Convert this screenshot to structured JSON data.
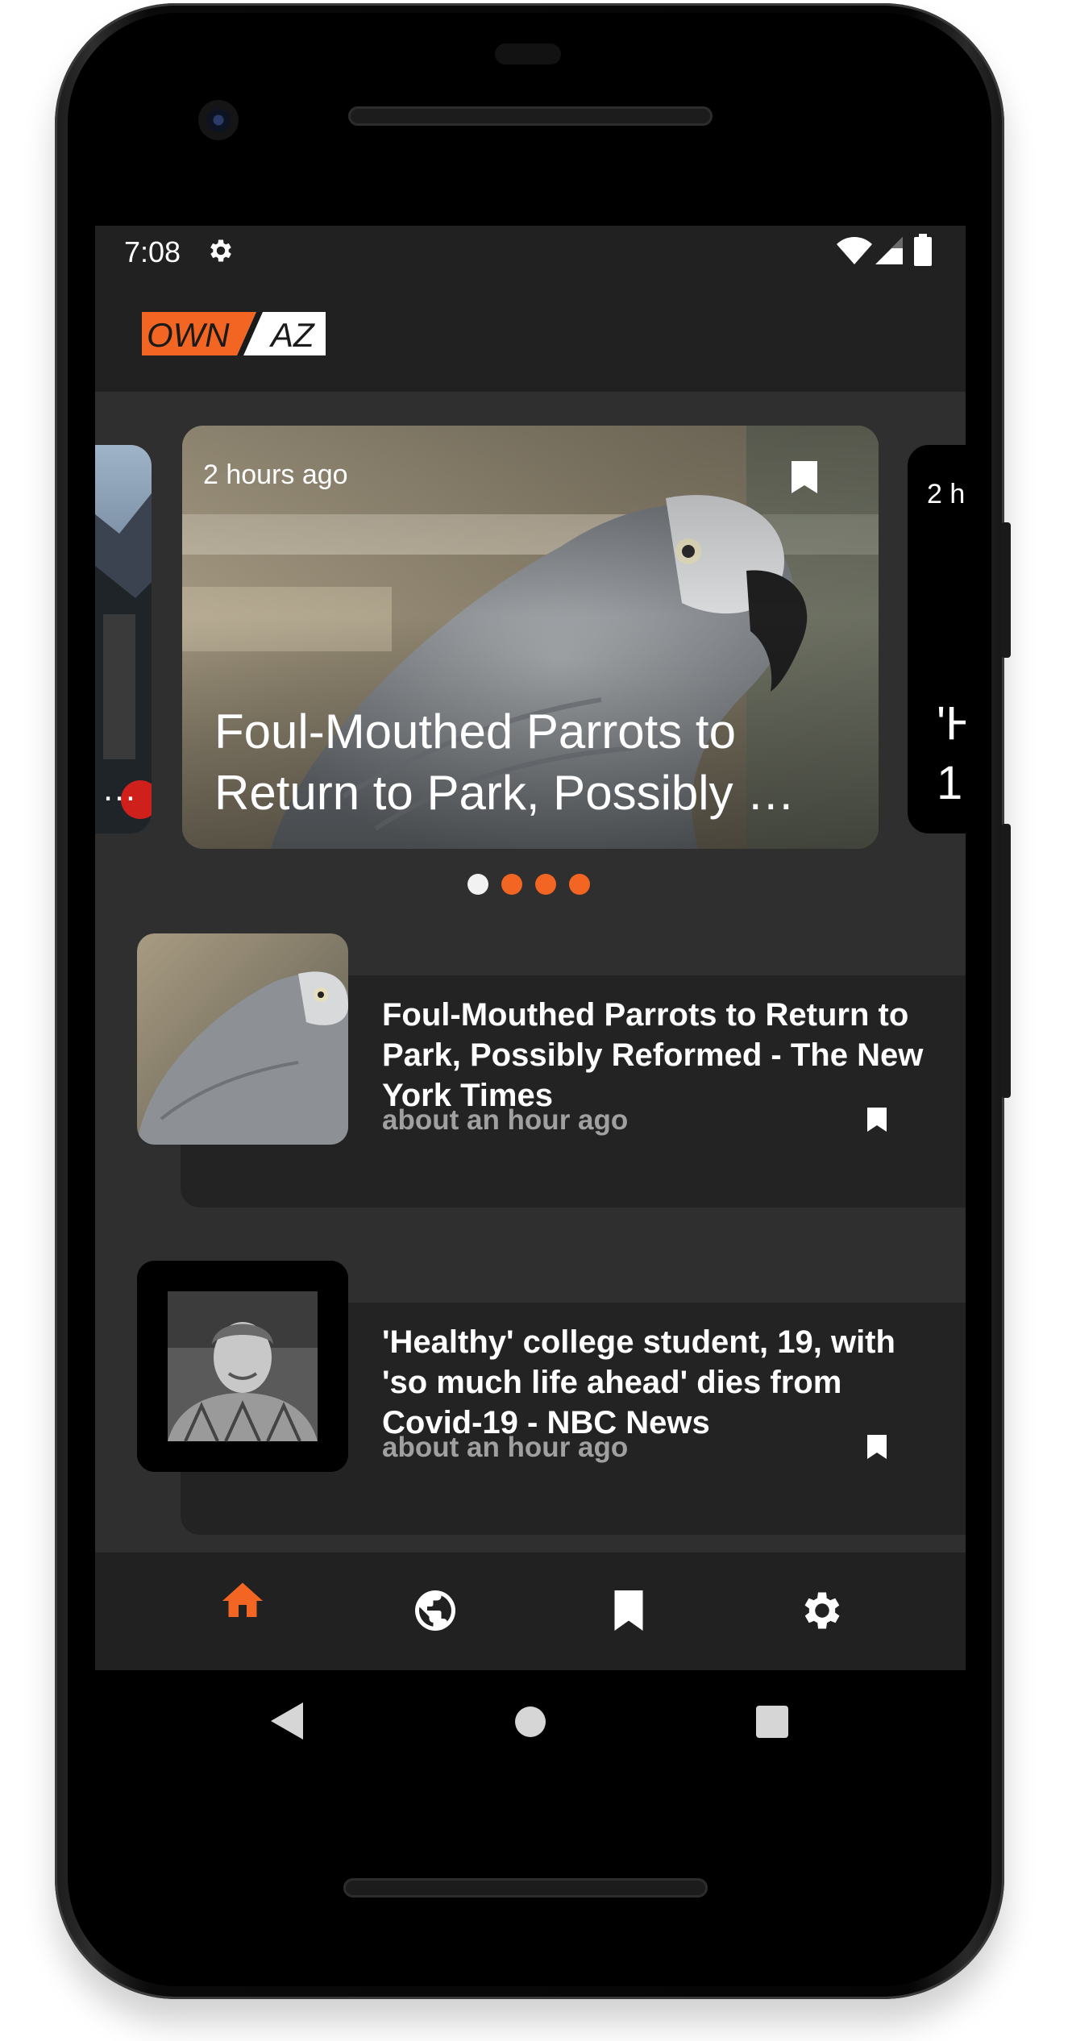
{
  "status_bar": {
    "time": "7:08",
    "icons": [
      "gear-icon",
      "wifi-icon",
      "signal-icon",
      "battery-icon"
    ]
  },
  "app_bar": {
    "logo_left": "OWN",
    "logo_right": "AZ"
  },
  "carousel": {
    "main": {
      "time": "2 hours ago",
      "title_line1": "Foul-Mouthed Parrots to",
      "title_line2": "Return to Park, Possibly …"
    },
    "left_peek": {
      "ellipsis": "…"
    },
    "right_peek": {
      "time": "2 h",
      "title_line1": "'H",
      "title_line2": "1"
    },
    "page_count": 4,
    "active_index": 0
  },
  "news": [
    {
      "title": "Foul-Mouthed Parrots to Return to Park, Possibly Reformed - The New York Times",
      "time": "about an hour ago"
    },
    {
      "title": "'Healthy' college student, 19, with 'so much life ahead' dies from Covid-19 - NBC News",
      "time": "about an hour ago"
    }
  ],
  "bottom_nav": {
    "items": [
      "home-icon",
      "globe-icon",
      "bookmark-icon",
      "settings-icon"
    ],
    "active": "home-icon"
  },
  "colors": {
    "accent": "#f26522",
    "appbar": "#212121",
    "background": "#2f2f2f",
    "card": "#232323",
    "muted_text": "#a0a0a0"
  }
}
